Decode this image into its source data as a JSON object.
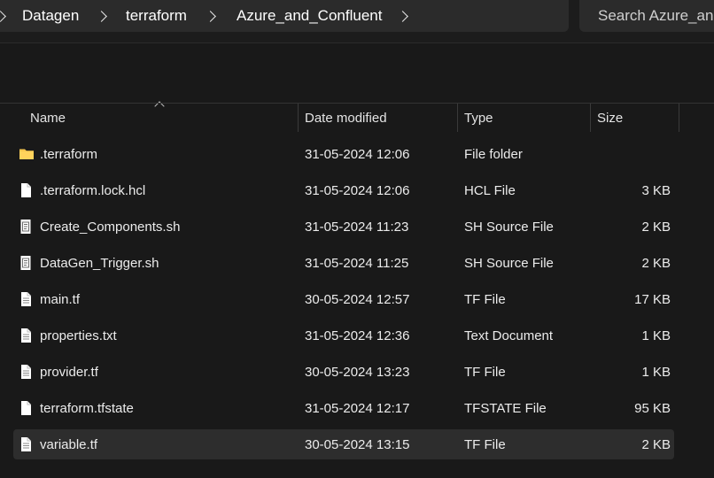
{
  "breadcrumb": {
    "items": [
      "Datagen",
      "terraform",
      "Azure_and_Confluent"
    ]
  },
  "search": {
    "placeholder": "Search Azure_and_Confluent"
  },
  "columns": {
    "name": "Name",
    "date": "Date modified",
    "type": "Type",
    "size": "Size"
  },
  "files": [
    {
      "name": ".terraform",
      "date": "31-05-2024 12:06",
      "type": "File folder",
      "size": "",
      "icon": "folder-icon"
    },
    {
      "name": ".terraform.lock.hcl",
      "date": "31-05-2024 12:06",
      "type": "HCL File",
      "size": "3 KB",
      "icon": "blank-file-icon"
    },
    {
      "name": "Create_Components.sh",
      "date": "31-05-2024 11:23",
      "type": "SH Source File",
      "size": "2 KB",
      "icon": "script-file-icon"
    },
    {
      "name": "DataGen_Trigger.sh",
      "date": "31-05-2024 11:25",
      "type": "SH Source File",
      "size": "2 KB",
      "icon": "script-file-icon"
    },
    {
      "name": "main.tf",
      "date": "30-05-2024 12:57",
      "type": "TF File",
      "size": "17 KB",
      "icon": "text-file-icon"
    },
    {
      "name": "properties.txt",
      "date": "31-05-2024 12:36",
      "type": "Text Document",
      "size": "1 KB",
      "icon": "text-file-icon"
    },
    {
      "name": "provider.tf",
      "date": "30-05-2024 13:23",
      "type": "TF File",
      "size": "1 KB",
      "icon": "text-file-icon"
    },
    {
      "name": "terraform.tfstate",
      "date": "31-05-2024 12:17",
      "type": "TFSTATE File",
      "size": "95 KB",
      "icon": "blank-file-icon"
    },
    {
      "name": "variable.tf",
      "date": "30-05-2024 13:15",
      "type": "TF File",
      "size": "2 KB",
      "icon": "text-file-icon"
    }
  ],
  "selected_file": "variable.tf",
  "colors": {
    "background": "#191919",
    "bar": "#2b2b2b",
    "selected_row": "#2d2d2d",
    "folder": "#f6c64e"
  }
}
